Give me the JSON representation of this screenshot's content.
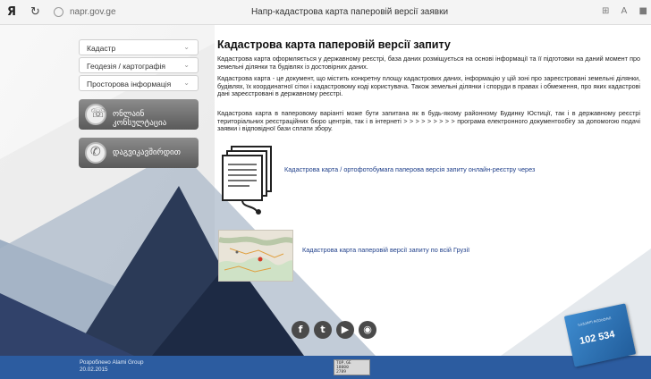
{
  "browser": {
    "logo": "Я",
    "reload_icon": "↻",
    "domain": "napr.gov.ge",
    "tab_title": "Напр-кадастрова карта паперовій версії заявки",
    "right_icons": [
      "⊞",
      "A",
      "■"
    ]
  },
  "nav": {
    "selects": [
      {
        "label": "Кадастр"
      },
      {
        "label": "Геодезія / картографія"
      },
      {
        "label": "Просторова інформація"
      }
    ],
    "geo_buttons": [
      {
        "label": "ონლაინ კონსულტაცია",
        "icon": "chat-icon"
      },
      {
        "label": "დაგვიკავშირდით",
        "icon": "phone-icon"
      }
    ]
  },
  "main": {
    "heading": "Кадастрова карта паперовій версії запиту",
    "para1": "Кадастрова карта оформляється у державному реєстрі, база даних розміщується на основі інформації та її підготовки на даний момент про земельні ділянки та будівлях із достовірних даних.",
    "para2": "Кадастрова карта - це документ, що містить конкретну площу кадастрових даних, інформацію у цій зоні про зареєстровані земельні ділянки, будівлях, їх координатної сітки і кадастровому коді користувача. Також земельні ділянки і споруди в правах і обмеження, про яких кадастрові дані зареєстровані в державному реєстрі.",
    "para3": "Кадастрова карта в паперовому варіанті може бути запитана як в будь-якому районному Будинку Юстиції, так і в державному реєстрі територіальних реєстраційних бюро центрів, так і в інтернеті > > > > > > > > > програма електронного документообігу за допомогою подачі заявки і відповідної бази сплати збору.",
    "link1": "Кадастрова карта / ортофотобумага паперова версія запиту онлайн-реєстру через",
    "link2": "Кадастрова карта паперовій версії запиту по всій Грузії"
  },
  "social": [
    {
      "icon": "facebook-icon",
      "glyph": "f"
    },
    {
      "icon": "twitter-icon",
      "glyph": "t"
    },
    {
      "icon": "youtube-icon",
      "glyph": "▶"
    },
    {
      "icon": "rss-icon",
      "glyph": "◉"
    }
  ],
  "footer": {
    "line1": "Розроблено Alami Group",
    "line2": "20.02.2015",
    "counter_lines": [
      "TOP.GE",
      "18000",
      "2789"
    ]
  },
  "promo": {
    "number": "102 534",
    "small": "ᲡᲐᲯᲐᲠᲝ ᲠᲔᲔᲡᲢᲠᲘ"
  },
  "colors": {
    "footer": "#2c5ca0",
    "link": "#1f3f8a",
    "dark_triangle": "#1d2a44"
  }
}
